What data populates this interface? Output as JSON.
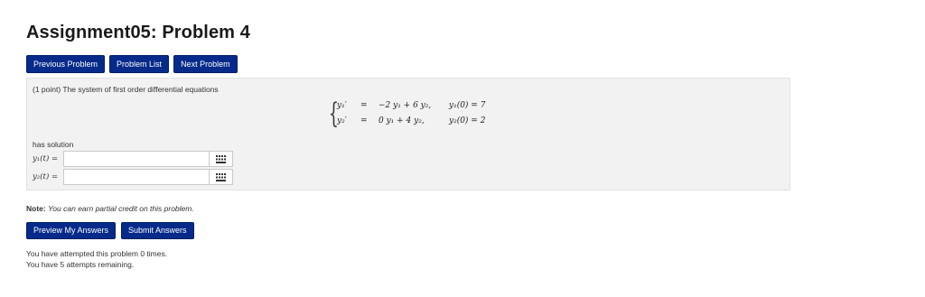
{
  "header": {
    "title": "Assignment05: Problem 4"
  },
  "nav": {
    "previous_label": "Previous Problem",
    "list_label": "Problem List",
    "next_label": "Next Problem"
  },
  "problem": {
    "intro": "(1 point) The system of first order differential equations",
    "system": {
      "equations": [
        {
          "lhs": "y₁′",
          "eq": "=",
          "rhs": "−2 y₁ + 6 y₂,",
          "ic": "y₁(0) = 7"
        },
        {
          "lhs": "y₂′",
          "eq": "=",
          "rhs": "0 y₁ + 4 y₂,",
          "ic": "y₂(0) = 2"
        }
      ]
    },
    "solution_label": "has solution",
    "answers": [
      {
        "label": "y₁(t) =",
        "value": ""
      },
      {
        "label": "y₂(t) =",
        "value": ""
      }
    ]
  },
  "note": {
    "prefix": "Note:",
    "text": "You can earn partial credit on this problem."
  },
  "actions": {
    "preview_label": "Preview My Answers",
    "submit_label": "Submit Answers"
  },
  "status": {
    "attempts_line": "You have attempted this problem 0 times.",
    "remaining_line": "You have 5 attempts remaining."
  },
  "colors": {
    "button": "#052a8a",
    "panel": "#f2f2f2"
  },
  "icons": {
    "equation_editor": "grid-icon"
  }
}
